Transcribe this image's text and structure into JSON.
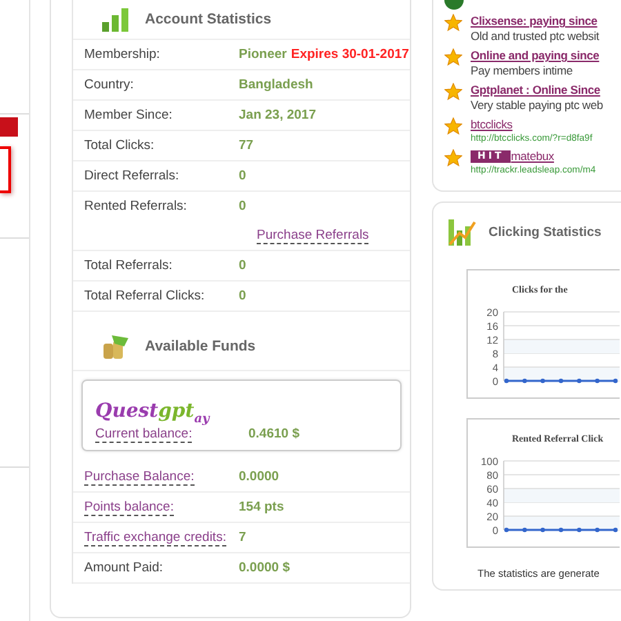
{
  "account_statistics": {
    "title": "Account Statistics",
    "rows": [
      {
        "label": "Membership:",
        "value": "Pioneer",
        "note": "Expires 30-01-2017"
      },
      {
        "label": "Country:",
        "value": "Bangladesh"
      },
      {
        "label": "Member Since:",
        "value": "Jan 23, 2017"
      },
      {
        "label": "Total Clicks:",
        "value": "77"
      },
      {
        "label": "Direct Referrals:",
        "value": "0"
      },
      {
        "label": "Rented Referrals:",
        "value": "0",
        "link": "Purchase Referrals"
      },
      {
        "label": "Total Referrals:",
        "value": "0"
      },
      {
        "label": "Total Referral Clicks:",
        "value": "0"
      }
    ]
  },
  "available_funds": {
    "title": "Available Funds",
    "wallet": {
      "logo_main": "Quest",
      "logo_accent": "gpt",
      "logo_tail": "ay",
      "label": "Current balance:",
      "value": "0.4610 $"
    },
    "rows": [
      {
        "label": "Purchase Balance:",
        "value": "0.0000",
        "kind": "link"
      },
      {
        "label": "Points balance:",
        "value": "154 pts",
        "kind": "link"
      },
      {
        "label": "Traffic exchange credits:",
        "value": "7",
        "kind": "link"
      },
      {
        "label": "Amount Paid:",
        "value": "0.0000 $",
        "kind": "plain"
      }
    ]
  },
  "featured": {
    "items": [
      {
        "kind": "text",
        "title": "Clixsense: paying since",
        "detail": "Old and trusted ptc websit"
      },
      {
        "kind": "text",
        "title": "Online and paying since",
        "detail": "Pay members intime"
      },
      {
        "kind": "text",
        "title": "Gptplanet : Online Since",
        "detail": "Very stable paying ptc web"
      },
      {
        "kind": "url",
        "title": "btcclicks",
        "detail": "http://btcclicks.com/?r=d8fa9f"
      },
      {
        "kind": "logo",
        "logo": "HIT",
        "title": "matebux",
        "detail": "http://trackr.leadsleap.com/m4"
      }
    ]
  },
  "clicking_statistics": {
    "title": "Clicking Statistics",
    "charts": [
      {
        "chart_data": {
          "type": "line",
          "title": "Clicks for the",
          "grid": true,
          "ylim": [
            0,
            20
          ],
          "yticks": [
            0,
            4,
            8,
            12,
            16,
            20
          ],
          "series": [
            {
              "color": "#3366cc",
              "marker": true,
              "values": [
                0,
                0,
                0,
                0,
                0,
                0,
                0
              ]
            }
          ]
        }
      },
      {
        "chart_data": {
          "type": "line",
          "title": "Rented Referral Click",
          "grid": true,
          "ylim": [
            0,
            100
          ],
          "yticks": [
            0,
            20,
            40,
            60,
            80,
            100
          ],
          "series": [
            {
              "color": "#3366cc",
              "marker": true,
              "values": [
                0,
                0,
                0,
                0,
                0,
                0,
                0
              ]
            }
          ]
        }
      }
    ],
    "footer": "The statistics are generate"
  }
}
